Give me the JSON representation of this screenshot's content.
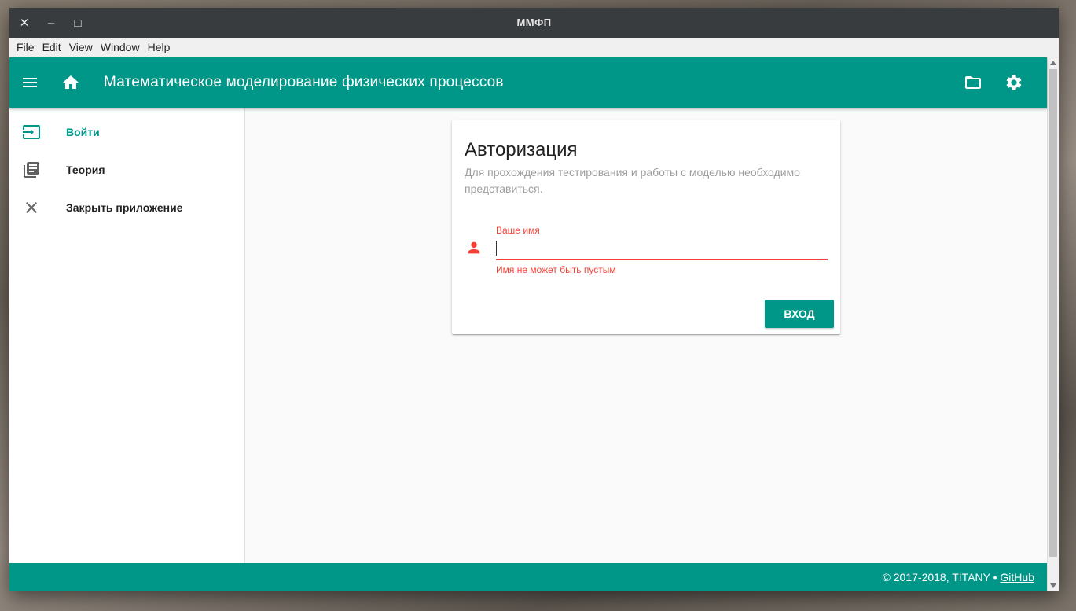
{
  "window": {
    "title": "ММФП",
    "controls": {
      "close": "✕",
      "minimize": "–",
      "maximize": "□"
    }
  },
  "menubar": [
    "File",
    "Edit",
    "View",
    "Window",
    "Help"
  ],
  "appbar": {
    "title": "Математическое моделирование физических процессов",
    "left_icons": [
      "menu-icon",
      "home-icon"
    ],
    "right_icons": [
      "folder-icon",
      "settings-icon"
    ]
  },
  "sidebar": {
    "items": [
      {
        "label": "Войти",
        "icon": "login-icon",
        "active": true
      },
      {
        "label": "Теория",
        "icon": "library-books-icon",
        "active": false
      },
      {
        "label": "Закрыть приложение",
        "icon": "close-icon",
        "active": false
      }
    ]
  },
  "auth_card": {
    "title": "Авторизация",
    "subtitle": "Для прохождения тестирования и работы с моделью необходимо представиться.",
    "name_field": {
      "label": "Ваше имя",
      "value": "",
      "error": "Имя не может быть пустым",
      "icon": "person-icon"
    },
    "submit_label": "ВХОД"
  },
  "footer": {
    "text": "© 2017-2018, TITANY •",
    "link": "GitHub"
  },
  "colors": {
    "primary": "#009688",
    "error": "#f44336",
    "titlebar": "#383c3f"
  }
}
